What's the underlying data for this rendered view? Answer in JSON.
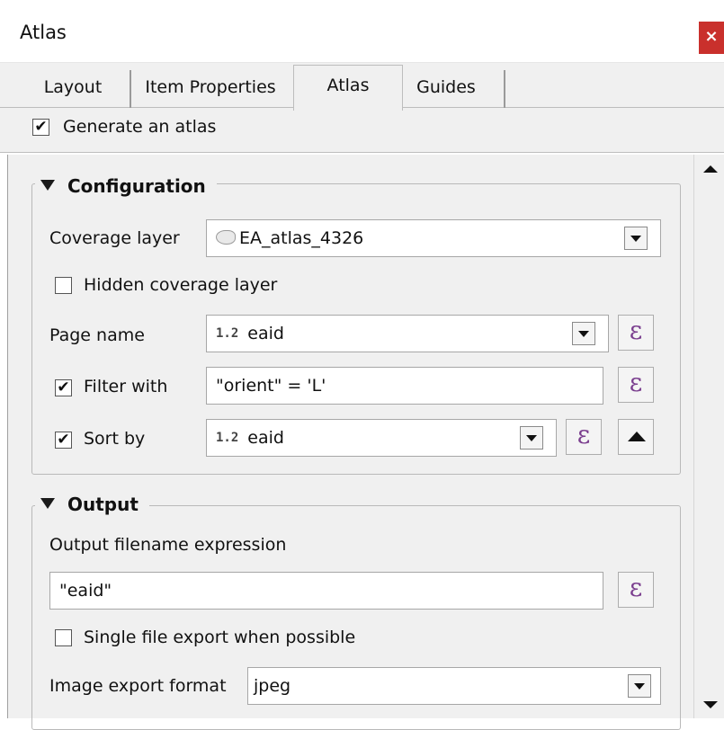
{
  "window": {
    "title": "Atlas",
    "close_label": "×"
  },
  "tabs": [
    {
      "label": "Layout"
    },
    {
      "label": "Item Properties"
    },
    {
      "label": "Atlas"
    },
    {
      "label": "Guides"
    }
  ],
  "generate_atlas": {
    "label": "Generate an atlas",
    "checked": true,
    "check_glyph": "✔"
  },
  "configuration": {
    "title": "Configuration",
    "coverage_layer": {
      "label": "Coverage layer",
      "value": "EA_atlas_4326",
      "icon": "polygon-layer-icon"
    },
    "hidden_coverage": {
      "label": "Hidden coverage layer",
      "checked": false
    },
    "page_name": {
      "label": "Page name",
      "type_badge": "1.2",
      "value": "eaid"
    },
    "filter_with": {
      "label": "Filter with",
      "checked": true,
      "value": "\"orient\"  = 'L'"
    },
    "sort_by": {
      "label": "Sort by",
      "checked": true,
      "type_badge": "1.2",
      "value": "eaid"
    },
    "expression_glyph": "ε"
  },
  "output": {
    "title": "Output",
    "filename_label": "Output filename expression",
    "filename_value": "\"eaid\"",
    "single_file": {
      "label": "Single file export when possible",
      "checked": false
    },
    "image_format": {
      "label": "Image export format",
      "value": "jpeg"
    }
  },
  "colors": {
    "close_button": "#c9302c",
    "expression_icon": "#7b3f8f",
    "panel_bg": "#f0f0f0"
  }
}
